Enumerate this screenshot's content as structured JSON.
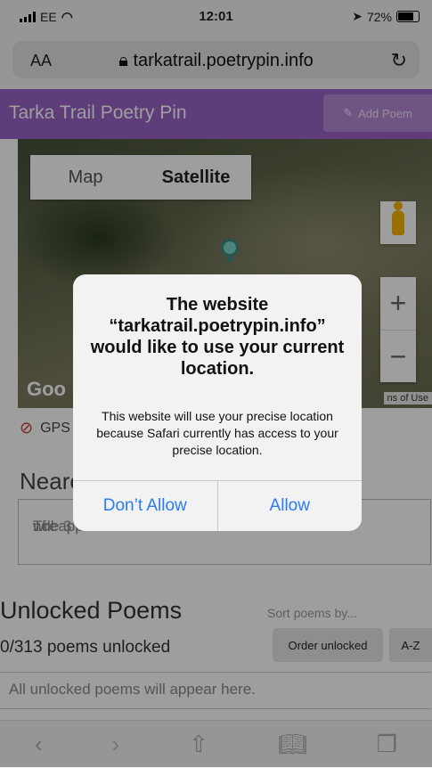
{
  "status": {
    "carrier": "EE",
    "time": "12:01",
    "battery": "72%"
  },
  "browser": {
    "text_size": "AA",
    "url": "tarkatrail.poetrypin.info"
  },
  "app": {
    "title": "Tarka Trail Poetry Pin",
    "add_label": "Add Poem"
  },
  "map": {
    "map_label": "Map",
    "satellite_label": "Satellite",
    "google": "Goo",
    "terms": "ns of Use"
  },
  "gps": {
    "label": "GPS"
  },
  "nearest": {
    "heading": "Neare",
    "text_left": "The 3",
    "text_right": "nce",
    "text_line2": "will appear here."
  },
  "unlocked": {
    "heading": "Unlocked Poems",
    "sort_label": "Sort poems by...",
    "count": "0/313 poems unlocked",
    "order_label": "Order unlocked",
    "az_label": "A-Z",
    "empty_text": "All unlocked poems will appear here."
  },
  "alert": {
    "title": "The website “tarkatrail.poetrypin.info” would like to use your current location.",
    "message": "This website will use your precise location because Safari currently has access to your precise location.",
    "deny": "Don’t Allow",
    "allow": "Allow"
  },
  "colors": {
    "header": "#9a63c7",
    "link": "#2b7bf3"
  }
}
